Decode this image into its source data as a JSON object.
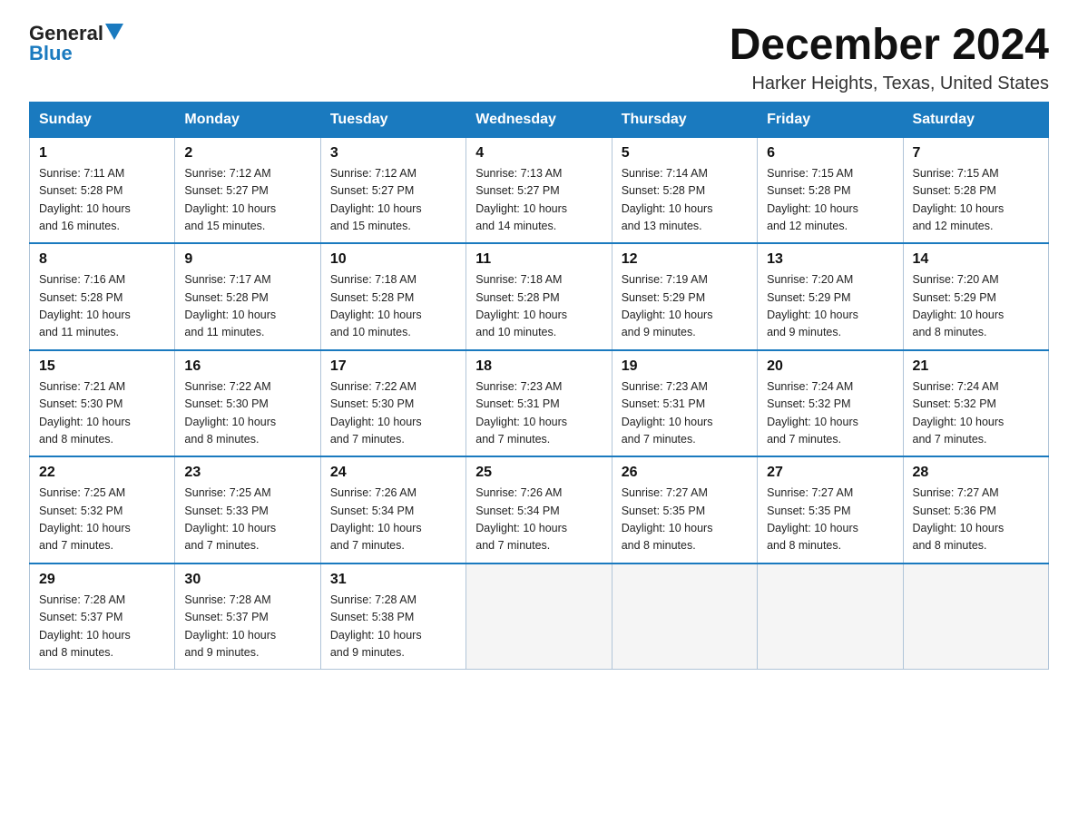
{
  "logo": {
    "text_general": "General",
    "text_blue": "Blue",
    "triangle_label": "logo-triangle"
  },
  "header": {
    "month_title": "December 2024",
    "location": "Harker Heights, Texas, United States"
  },
  "weekdays": [
    "Sunday",
    "Monday",
    "Tuesday",
    "Wednesday",
    "Thursday",
    "Friday",
    "Saturday"
  ],
  "weeks": [
    [
      {
        "day": "1",
        "sunrise": "7:11 AM",
        "sunset": "5:28 PM",
        "daylight": "10 hours and 16 minutes."
      },
      {
        "day": "2",
        "sunrise": "7:12 AM",
        "sunset": "5:27 PM",
        "daylight": "10 hours and 15 minutes."
      },
      {
        "day": "3",
        "sunrise": "7:12 AM",
        "sunset": "5:27 PM",
        "daylight": "10 hours and 15 minutes."
      },
      {
        "day": "4",
        "sunrise": "7:13 AM",
        "sunset": "5:27 PM",
        "daylight": "10 hours and 14 minutes."
      },
      {
        "day": "5",
        "sunrise": "7:14 AM",
        "sunset": "5:28 PM",
        "daylight": "10 hours and 13 minutes."
      },
      {
        "day": "6",
        "sunrise": "7:15 AM",
        "sunset": "5:28 PM",
        "daylight": "10 hours and 12 minutes."
      },
      {
        "day": "7",
        "sunrise": "7:15 AM",
        "sunset": "5:28 PM",
        "daylight": "10 hours and 12 minutes."
      }
    ],
    [
      {
        "day": "8",
        "sunrise": "7:16 AM",
        "sunset": "5:28 PM",
        "daylight": "10 hours and 11 minutes."
      },
      {
        "day": "9",
        "sunrise": "7:17 AM",
        "sunset": "5:28 PM",
        "daylight": "10 hours and 11 minutes."
      },
      {
        "day": "10",
        "sunrise": "7:18 AM",
        "sunset": "5:28 PM",
        "daylight": "10 hours and 10 minutes."
      },
      {
        "day": "11",
        "sunrise": "7:18 AM",
        "sunset": "5:28 PM",
        "daylight": "10 hours and 10 minutes."
      },
      {
        "day": "12",
        "sunrise": "7:19 AM",
        "sunset": "5:29 PM",
        "daylight": "10 hours and 9 minutes."
      },
      {
        "day": "13",
        "sunrise": "7:20 AM",
        "sunset": "5:29 PM",
        "daylight": "10 hours and 9 minutes."
      },
      {
        "day": "14",
        "sunrise": "7:20 AM",
        "sunset": "5:29 PM",
        "daylight": "10 hours and 8 minutes."
      }
    ],
    [
      {
        "day": "15",
        "sunrise": "7:21 AM",
        "sunset": "5:30 PM",
        "daylight": "10 hours and 8 minutes."
      },
      {
        "day": "16",
        "sunrise": "7:22 AM",
        "sunset": "5:30 PM",
        "daylight": "10 hours and 8 minutes."
      },
      {
        "day": "17",
        "sunrise": "7:22 AM",
        "sunset": "5:30 PM",
        "daylight": "10 hours and 7 minutes."
      },
      {
        "day": "18",
        "sunrise": "7:23 AM",
        "sunset": "5:31 PM",
        "daylight": "10 hours and 7 minutes."
      },
      {
        "day": "19",
        "sunrise": "7:23 AM",
        "sunset": "5:31 PM",
        "daylight": "10 hours and 7 minutes."
      },
      {
        "day": "20",
        "sunrise": "7:24 AM",
        "sunset": "5:32 PM",
        "daylight": "10 hours and 7 minutes."
      },
      {
        "day": "21",
        "sunrise": "7:24 AM",
        "sunset": "5:32 PM",
        "daylight": "10 hours and 7 minutes."
      }
    ],
    [
      {
        "day": "22",
        "sunrise": "7:25 AM",
        "sunset": "5:32 PM",
        "daylight": "10 hours and 7 minutes."
      },
      {
        "day": "23",
        "sunrise": "7:25 AM",
        "sunset": "5:33 PM",
        "daylight": "10 hours and 7 minutes."
      },
      {
        "day": "24",
        "sunrise": "7:26 AM",
        "sunset": "5:34 PM",
        "daylight": "10 hours and 7 minutes."
      },
      {
        "day": "25",
        "sunrise": "7:26 AM",
        "sunset": "5:34 PM",
        "daylight": "10 hours and 7 minutes."
      },
      {
        "day": "26",
        "sunrise": "7:27 AM",
        "sunset": "5:35 PM",
        "daylight": "10 hours and 8 minutes."
      },
      {
        "day": "27",
        "sunrise": "7:27 AM",
        "sunset": "5:35 PM",
        "daylight": "10 hours and 8 minutes."
      },
      {
        "day": "28",
        "sunrise": "7:27 AM",
        "sunset": "5:36 PM",
        "daylight": "10 hours and 8 minutes."
      }
    ],
    [
      {
        "day": "29",
        "sunrise": "7:28 AM",
        "sunset": "5:37 PM",
        "daylight": "10 hours and 8 minutes."
      },
      {
        "day": "30",
        "sunrise": "7:28 AM",
        "sunset": "5:37 PM",
        "daylight": "10 hours and 9 minutes."
      },
      {
        "day": "31",
        "sunrise": "7:28 AM",
        "sunset": "5:38 PM",
        "daylight": "10 hours and 9 minutes."
      },
      null,
      null,
      null,
      null
    ]
  ],
  "labels": {
    "sunrise": "Sunrise:",
    "sunset": "Sunset:",
    "daylight": "Daylight:"
  }
}
